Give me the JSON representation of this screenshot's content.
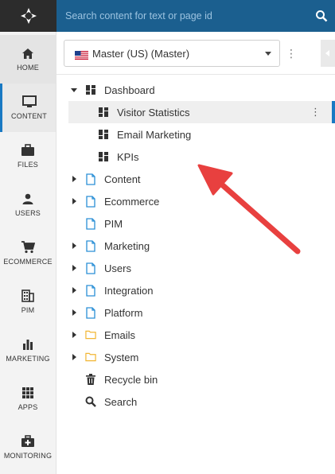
{
  "search": {
    "placeholder": "Search content for text or page id"
  },
  "nav": [
    {
      "key": "home",
      "label": "HOME"
    },
    {
      "key": "content",
      "label": "CONTENT"
    },
    {
      "key": "files",
      "label": "FILES"
    },
    {
      "key": "users",
      "label": "USERS"
    },
    {
      "key": "ecommerce",
      "label": "ECOMMERCE"
    },
    {
      "key": "pim",
      "label": "PIM"
    },
    {
      "key": "marketing",
      "label": "MARKETING"
    },
    {
      "key": "apps",
      "label": "APPS"
    },
    {
      "key": "monitoring",
      "label": "MONITORING"
    }
  ],
  "selector": {
    "value": "Master (US) (Master)"
  },
  "tree": [
    {
      "label": "Dashboard"
    },
    {
      "label": "Visitor Statistics"
    },
    {
      "label": "Email Marketing"
    },
    {
      "label": "KPIs"
    },
    {
      "label": "Content"
    },
    {
      "label": "Ecommerce"
    },
    {
      "label": "PIM"
    },
    {
      "label": "Marketing"
    },
    {
      "label": "Users"
    },
    {
      "label": "Integration"
    },
    {
      "label": "Platform"
    },
    {
      "label": "Emails"
    },
    {
      "label": "System"
    },
    {
      "label": "Recycle bin"
    },
    {
      "label": "Search"
    }
  ],
  "colors": {
    "header": "#1b5f8f",
    "accent": "#1979c3",
    "arrow": "#e8403f",
    "folder": "#f2b634",
    "page": "#2a8fd6"
  }
}
